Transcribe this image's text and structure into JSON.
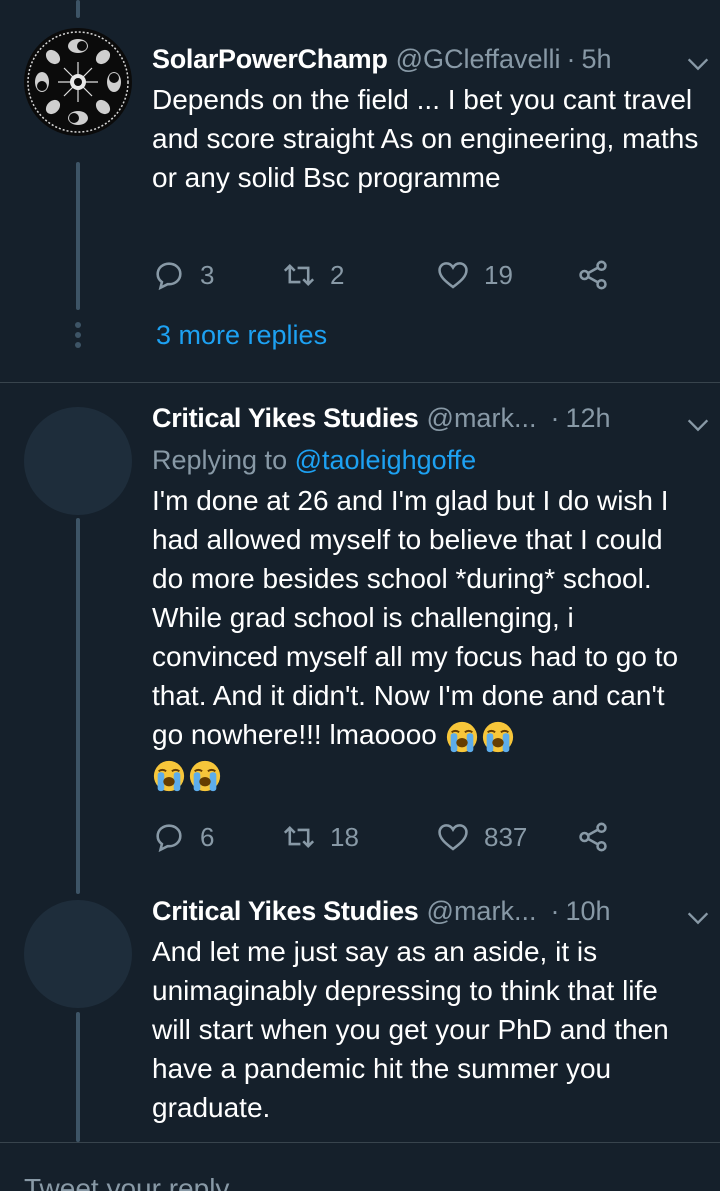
{
  "tweets": [
    {
      "name": "SolarPowerChamp",
      "handle": "@GCleffavelli",
      "separator": "·",
      "time": "5h",
      "text": "Depends on the field ... I bet you cant travel and score straight As on engineering, maths or any solid Bsc programme",
      "replies": "3",
      "retweets": "2",
      "likes": "19"
    },
    {
      "name": "Critical Yikes Studies",
      "handle": "@mark...",
      "separator": "·",
      "time": "12h",
      "replying_prefix": "Replying to",
      "replying_handle": "@taoleighgoffe",
      "text": "I'm done at 26 and I'm glad but I do wish I had allowed myself to believe that I could do more besides school *during* school. While grad school is challenging, i convinced myself all my focus had to go to that. And it didn't. Now I'm done and can't go nowhere!!! lmaoooo",
      "replies": "6",
      "retweets": "18",
      "likes": "837"
    },
    {
      "name": "Critical Yikes Studies",
      "handle": "@mark...",
      "separator": "·",
      "time": "10h",
      "text": "And let me just say as an aside, it is unimaginably depressing to think that life will start when you get your PhD and then have a pandemic hit the summer you graduate."
    }
  ],
  "more_replies_label": "3 more replies",
  "compose": {
    "placeholder": "Tweet your reply"
  },
  "icons": {
    "reply": "reply-icon",
    "retweet": "retweet-icon",
    "like": "heart-icon",
    "share": "share-icon",
    "menu": "chevron-down-icon",
    "emoji": "loudly-crying-face-emoji"
  },
  "colors": {
    "background": "#15202b",
    "text": "#ffffff",
    "secondary": "#8899a6",
    "link": "#1da1f2",
    "divider": "#38444d"
  }
}
